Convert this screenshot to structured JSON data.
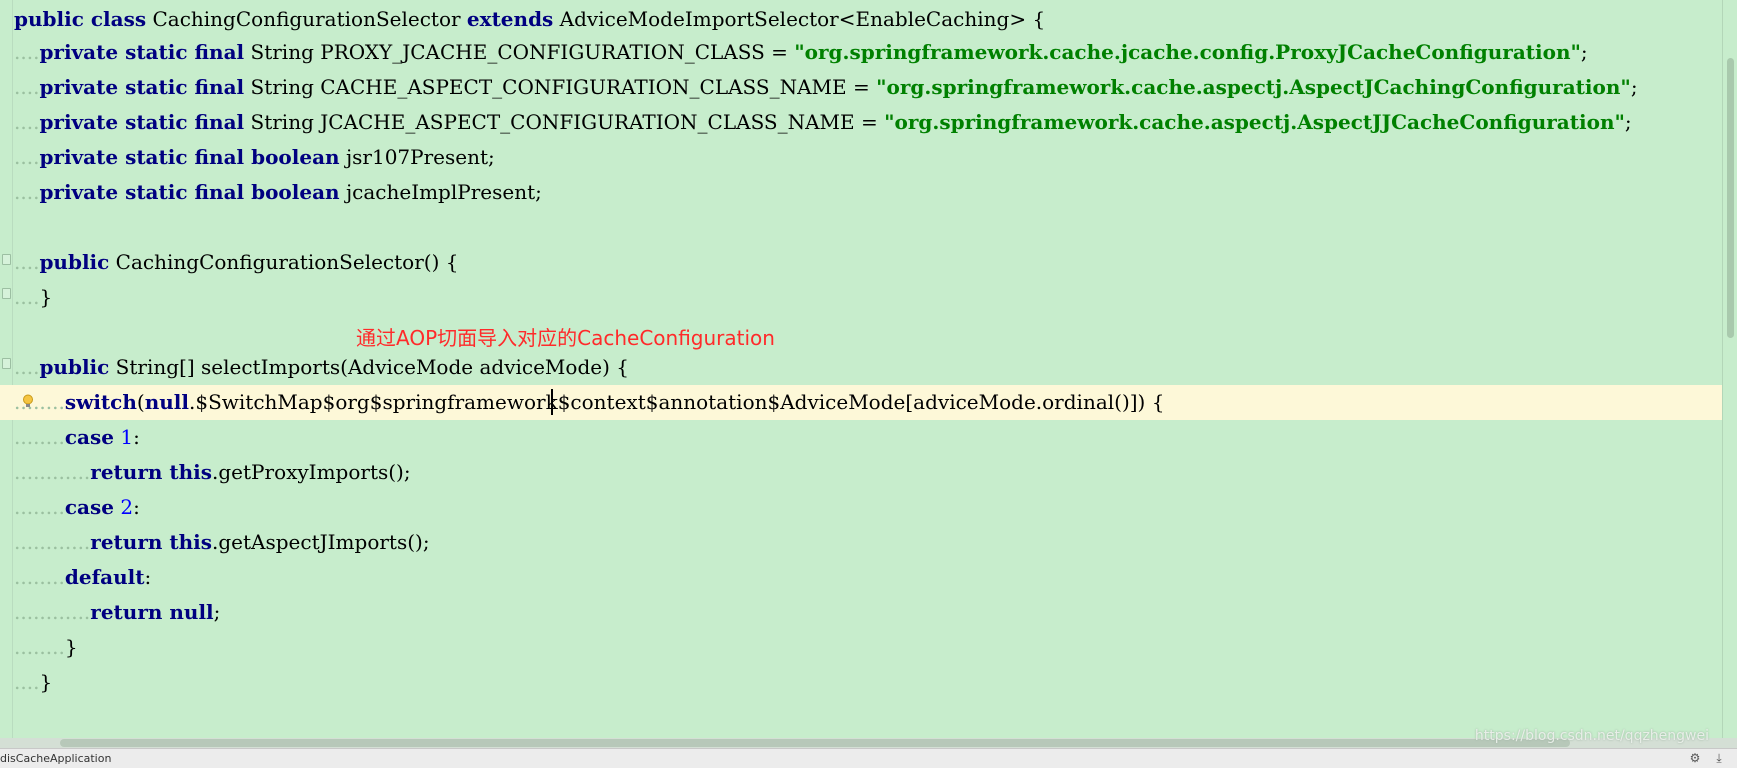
{
  "editor": {
    "lines": [
      {
        "segs": [
          {
            "t": "public class",
            "c": "kw"
          },
          {
            "t": " CachingConfigurationSelector "
          },
          {
            "t": "extends",
            "c": "kw"
          },
          {
            "t": " AdviceModeImportSelector<EnableCaching> {"
          }
        ]
      },
      {
        "segs": [
          {
            "t": "....",
            "c": "guide"
          },
          {
            "t": "private static final",
            "c": "kw"
          },
          {
            "t": " String PROXY_JCACHE_CONFIGURATION_CLASS = "
          },
          {
            "t": "\"org.springframework.cache.jcache.config.ProxyJCacheConfiguration\"",
            "c": "str"
          },
          {
            "t": ";"
          }
        ]
      },
      {
        "segs": [
          {
            "t": "....",
            "c": "guide"
          },
          {
            "t": "private static final",
            "c": "kw"
          },
          {
            "t": " String CACHE_ASPECT_CONFIGURATION_CLASS_NAME = "
          },
          {
            "t": "\"org.springframework.cache.aspectj.AspectJCachingConfiguration\"",
            "c": "str"
          },
          {
            "t": ";"
          }
        ]
      },
      {
        "segs": [
          {
            "t": "....",
            "c": "guide"
          },
          {
            "t": "private static final",
            "c": "kw"
          },
          {
            "t": " String JCACHE_ASPECT_CONFIGURATION_CLASS_NAME = "
          },
          {
            "t": "\"org.springframework.cache.aspectj.AspectJJCacheConfiguration\"",
            "c": "str"
          },
          {
            "t": ";"
          }
        ]
      },
      {
        "segs": [
          {
            "t": "....",
            "c": "guide"
          },
          {
            "t": "private static final boolean",
            "c": "kw"
          },
          {
            "t": " jsr107Present;"
          }
        ]
      },
      {
        "segs": [
          {
            "t": "....",
            "c": "guide"
          },
          {
            "t": "private static final boolean",
            "c": "kw"
          },
          {
            "t": " jcacheImplPresent;"
          }
        ]
      },
      {
        "segs": []
      },
      {
        "segs": [
          {
            "t": "....",
            "c": "guide"
          },
          {
            "t": "public",
            "c": "kw"
          },
          {
            "t": " CachingConfigurationSelector() {"
          }
        ]
      },
      {
        "segs": [
          {
            "t": "....",
            "c": "guide"
          },
          {
            "t": "}"
          }
        ]
      },
      {
        "segs": []
      },
      {
        "segs": [
          {
            "t": "....",
            "c": "guide"
          },
          {
            "t": "public",
            "c": "kw"
          },
          {
            "t": " String[] selectImports(AdviceMode adviceMode) {"
          }
        ]
      },
      {
        "segs": [
          {
            "t": "........",
            "c": "guide"
          },
          {
            "t": "switch",
            "c": "kw"
          },
          {
            "t": "("
          },
          {
            "t": "null",
            "c": "kw"
          },
          {
            "t": ".$SwitchMap$org$springframework$context$annotation$AdviceMode[adviceMode.ordinal()]) {"
          }
        ],
        "current": true
      },
      {
        "segs": [
          {
            "t": "........",
            "c": "guide"
          },
          {
            "t": "case",
            "c": "kw"
          },
          {
            "t": " "
          },
          {
            "t": "1",
            "c": "num"
          },
          {
            "t": ":"
          }
        ]
      },
      {
        "segs": [
          {
            "t": "............",
            "c": "guide"
          },
          {
            "t": "return this",
            "c": "kw"
          },
          {
            "t": ".getProxyImports();"
          }
        ]
      },
      {
        "segs": [
          {
            "t": "........",
            "c": "guide"
          },
          {
            "t": "case",
            "c": "kw"
          },
          {
            "t": " "
          },
          {
            "t": "2",
            "c": "num"
          },
          {
            "t": ":"
          }
        ]
      },
      {
        "segs": [
          {
            "t": "............",
            "c": "guide"
          },
          {
            "t": "return this",
            "c": "kw"
          },
          {
            "t": ".getAspectJImports();"
          }
        ]
      },
      {
        "segs": [
          {
            "t": "........",
            "c": "guide"
          },
          {
            "t": "default",
            "c": "kw"
          },
          {
            "t": ":"
          }
        ]
      },
      {
        "segs": [
          {
            "t": "............",
            "c": "guide"
          },
          {
            "t": "return null",
            "c": "kw"
          },
          {
            "t": ";"
          }
        ]
      },
      {
        "segs": [
          {
            "t": "........",
            "c": "guide"
          },
          {
            "t": "}"
          }
        ]
      },
      {
        "segs": [
          {
            "t": "....",
            "c": "guide"
          },
          {
            "t": "}"
          }
        ]
      }
    ],
    "annotation": "通过AOP切面导入对应的CacheConfiguration"
  },
  "statusbar": {
    "left": "disCacheApplication",
    "watermark": "https://blog.csdn.net/qqzhengwei",
    "icons": [
      "gear-icon",
      "download-icon"
    ]
  }
}
